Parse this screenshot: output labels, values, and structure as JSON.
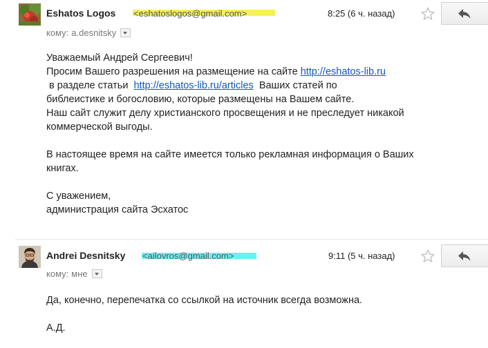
{
  "messages": [
    {
      "sender_name": "Eshatos Logos",
      "sender_email": "<eshatoslogos@gmail.com>",
      "time": "8:25 (6 ч. назад)",
      "to_label": "кому:",
      "to_value": "a.desnitsky",
      "highlight_color": "#f2ef3a",
      "body": {
        "greeting": "Уважаемый Андрей Сергеевич!",
        "line1_text": "Просим Вашего разрешения на размещение на сайте ",
        "line1_link": "http://eshatos-lib.ru",
        "line2_pre": " в разделе статьи  ",
        "line2_link": "http://eshatos-lib.ru/articles",
        "line2_post": "  Ваших статей по",
        "line3": "библеистике и богословию, которые размещены на Вашем сайте.",
        "line4": "Наш сайт служит делу христианского просвещения и не преследует никакой",
        "line5": "коммерческой выгоды.",
        "line6": "В настоящее время на сайте имеется только рекламная информация о Ваших",
        "line7": "книгах.",
        "line8": "С уважением,",
        "line9": "администрация сайта Эсхатос"
      }
    },
    {
      "sender_name": "Andrei Desnitsky",
      "sender_email": "<ailovros@gmail.com>",
      "time": "9:11 (5 ч. назад)",
      "to_label": "кому:",
      "to_value": "мне",
      "highlight_color": "#4ff0f0",
      "body": {
        "line1": "Да, конечно, перепечатка со ссылкой на источник всегда возможна.",
        "line2": "А.Д."
      }
    }
  ],
  "icons": {
    "star": "star-outline-icon",
    "reply": "reply-arrow-icon",
    "dropdown": "chevron-down-icon"
  }
}
